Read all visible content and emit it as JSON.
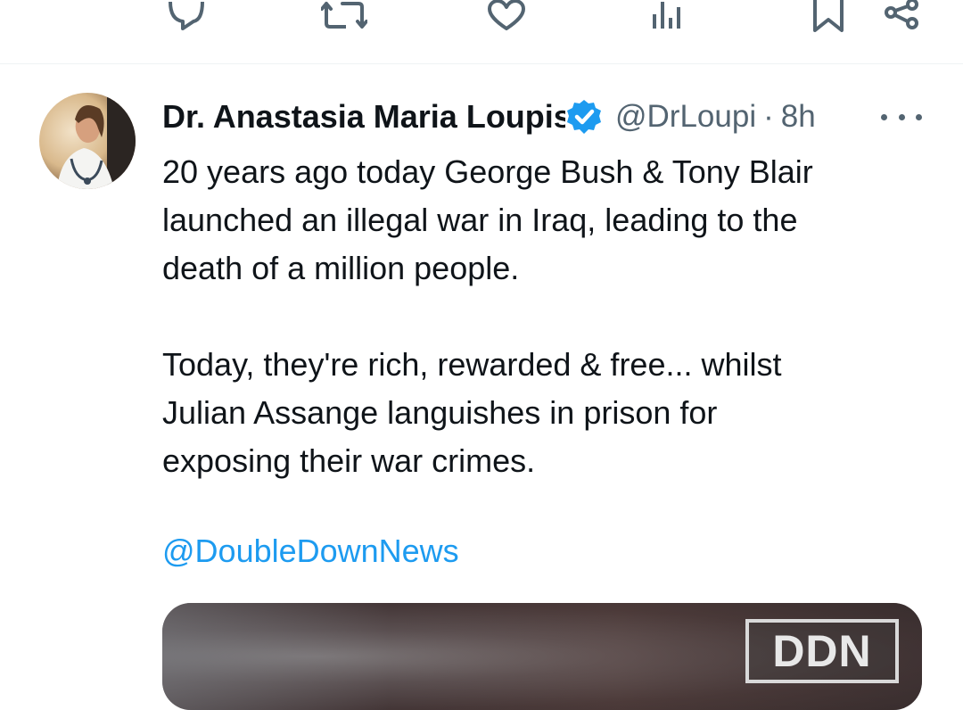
{
  "action_bar": {
    "icons": [
      "reply-icon",
      "retweet-icon",
      "like-icon",
      "views-icon",
      "bookmark-icon",
      "share-icon"
    ]
  },
  "tweet": {
    "author": {
      "display_name": "Dr. Anastasia Maria Loupis",
      "handle": "@DrLoupi",
      "verified": true
    },
    "separator": "·",
    "time": "8h",
    "body": "20 years ago today George Bush & Tony Blair\nlaunched an illegal war in Iraq, leading to the\ndeath of a million people.\n\nToday, they're rich, rewarded & free... whilst\nJulian Assange languishes in prison for\nexposing their war crimes.",
    "mention": "@DoubleDownNews",
    "media": {
      "logo_text": "DDN"
    }
  },
  "colors": {
    "text": "#0f1419",
    "muted": "#536471",
    "accent": "#1d9bf0",
    "divider": "#eff3f4"
  }
}
